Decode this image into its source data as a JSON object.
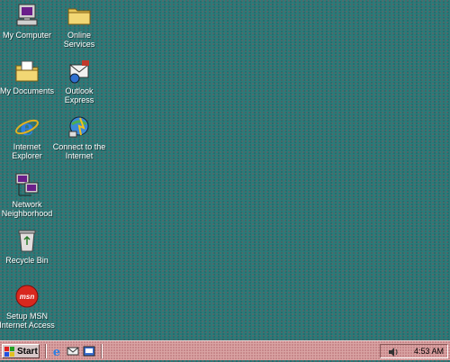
{
  "desktop": {
    "icons": [
      {
        "label": "My Computer",
        "icon": "computer-icon"
      },
      {
        "label": "Online Services",
        "icon": "folder-icon"
      },
      {
        "label": "My Documents",
        "icon": "documents-folder-icon"
      },
      {
        "label": "Outlook Express",
        "icon": "outlook-express-icon"
      },
      {
        "label": "Internet Explorer",
        "icon": "internet-explorer-icon"
      },
      {
        "label": "Connect to the Internet",
        "icon": "connect-internet-icon"
      },
      {
        "label": "Network Neighborhood",
        "icon": "network-icon"
      },
      {
        "label": "Recycle Bin",
        "icon": "recycle-bin-icon"
      },
      {
        "label": "Setup MSN Internet Access",
        "icon": "msn-icon"
      }
    ]
  },
  "taskbar": {
    "start_label": "Start",
    "quick_launch": [
      "internet-explorer-icon",
      "outlook-express-icon",
      "show-desktop-icon"
    ],
    "clock": "4:53 AM",
    "tray_icon": "volume-icon"
  },
  "colors": {
    "desktop": "#2c7a78",
    "taskbar": "#d9a3a3",
    "label_text": "#ffffff"
  }
}
